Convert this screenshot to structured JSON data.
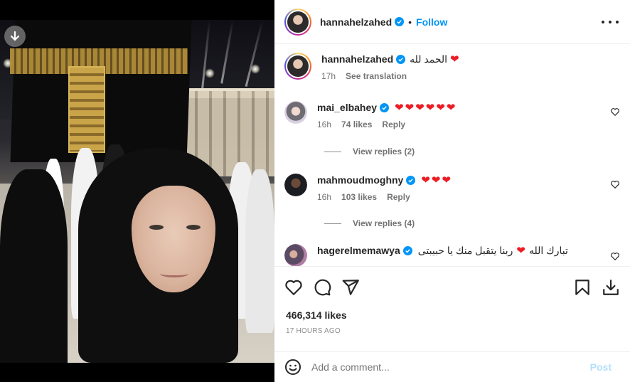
{
  "post": {
    "author": "hannahelzahed",
    "follow_label": "Follow",
    "separator": "•",
    "caption": "الحمد لله",
    "caption_time": "17h",
    "see_translation": "See translation",
    "likes": "466,314 likes",
    "timestamp": "17 HOURS AGO"
  },
  "comments": [
    {
      "username": "mai_elbahey",
      "text": "",
      "hearts": "❤❤❤❤❤❤",
      "time": "16h",
      "likes": "74 likes",
      "reply": "Reply",
      "view_replies": "View replies (2)"
    },
    {
      "username": "mahmoudmoghny",
      "text": "",
      "hearts": "❤❤❤",
      "time": "16h",
      "likes": "103 likes",
      "reply": "Reply",
      "view_replies": "View replies (4)"
    },
    {
      "username": "hagerelmemawya",
      "text_before": "ربنا يتقبل منك يا حبيبتى",
      "text_after": "تبارك الله",
      "hearts": "❤"
    }
  ],
  "comment_box": {
    "placeholder": "Add a comment...",
    "post_label": "Post"
  },
  "colors": {
    "accent": "#0095f6",
    "heart": "#ed1c24",
    "post_disabled": "#b2dffc"
  },
  "icons": [
    "download-icon",
    "verified-icon",
    "more-icon",
    "heart-icon",
    "comment-icon",
    "share-icon",
    "bookmark-icon",
    "save-download-icon",
    "emoji-icon"
  ]
}
